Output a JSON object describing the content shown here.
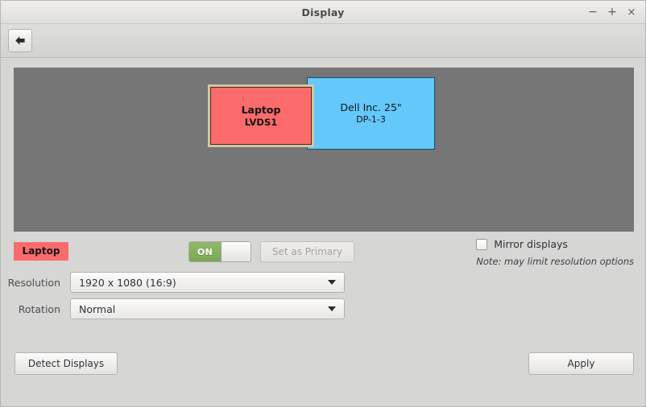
{
  "window": {
    "title": "Display",
    "controls": {
      "minimize": "−",
      "maximize": "+",
      "close": "×"
    }
  },
  "toolbar": {
    "back_label": "Back"
  },
  "preview": {
    "monitors": [
      {
        "name": "Laptop",
        "port": "LVDS1",
        "color": "#fb6b6b",
        "selected": true
      },
      {
        "name": "Dell Inc. 25\"",
        "port": "DP-1-3",
        "color": "#64c8fb",
        "selected": false
      }
    ]
  },
  "controls": {
    "active_display_badge": "Laptop",
    "power_toggle_label": "ON",
    "set_as_primary_label": "Set as Primary",
    "mirror_checkbox_label": "Mirror displays",
    "mirror_note": "Note: may limit resolution options"
  },
  "form": {
    "resolution": {
      "label": "Resolution",
      "value": "1920 x 1080 (16:9)"
    },
    "rotation": {
      "label": "Rotation",
      "value": "Normal"
    }
  },
  "actions": {
    "detect_displays_label": "Detect Displays",
    "apply_label": "Apply"
  }
}
